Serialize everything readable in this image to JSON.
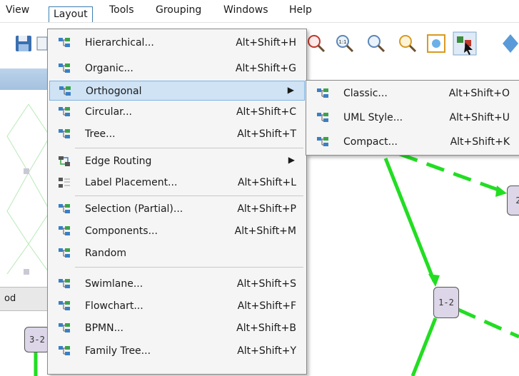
{
  "menubar": {
    "items": [
      {
        "label": "View"
      },
      {
        "label": "Layout"
      },
      {
        "label": "Tools"
      },
      {
        "label": "Grouping"
      },
      {
        "label": "Windows"
      },
      {
        "label": "Help"
      }
    ]
  },
  "layout_menu": {
    "items": [
      {
        "label": "Hierarchical...",
        "shortcut": "Alt+Shift+H",
        "icon": "layout-icon"
      },
      {
        "label": "Organic...",
        "shortcut": "Alt+Shift+G",
        "icon": "layout-icon"
      },
      {
        "label": "Orthogonal",
        "shortcut": "",
        "icon": "layout-icon",
        "submenu": true,
        "highlighted": true
      },
      {
        "label": "Circular...",
        "shortcut": "Alt+Shift+C",
        "icon": "layout-icon"
      },
      {
        "label": "Tree...",
        "shortcut": "Alt+Shift+T",
        "icon": "layout-icon"
      },
      {
        "label": "Edge Routing",
        "shortcut": "",
        "icon": "edge-routing-icon",
        "submenu": true
      },
      {
        "label": "Label Placement...",
        "shortcut": "Alt+Shift+L",
        "icon": "label-placement-icon"
      },
      {
        "label": "Selection (Partial)...",
        "shortcut": "Alt+Shift+P",
        "icon": "layout-icon"
      },
      {
        "label": "Components...",
        "shortcut": "Alt+Shift+M",
        "icon": "layout-icon"
      },
      {
        "label": "Random",
        "shortcut": "",
        "icon": "layout-icon"
      },
      {
        "label": "Swimlane...",
        "shortcut": "Alt+Shift+S",
        "icon": "layout-icon"
      },
      {
        "label": "Flowchart...",
        "shortcut": "Alt+Shift+F",
        "icon": "layout-icon"
      },
      {
        "label": "BPMN...",
        "shortcut": "Alt+Shift+B",
        "icon": "layout-icon"
      },
      {
        "label": "Family Tree...",
        "shortcut": "Alt+Shift+Y",
        "icon": "layout-icon"
      }
    ]
  },
  "orthogonal_submenu": {
    "items": [
      {
        "label": "Classic...",
        "shortcut": "Alt+Shift+O",
        "icon": "layout-icon"
      },
      {
        "label": "UML Style...",
        "shortcut": "Alt+Shift+U",
        "icon": "layout-icon"
      },
      {
        "label": "Compact...",
        "shortcut": "Alt+Shift+K",
        "icon": "layout-icon"
      }
    ]
  },
  "canvas": {
    "nodes": [
      {
        "label": "1-2"
      },
      {
        "label": "3-2"
      },
      {
        "label": "2"
      }
    ],
    "tab_label": "od"
  },
  "colors": {
    "edge_green": "#22dd22",
    "node_fill": "#dcd6e8",
    "menu_highlight": "#cfe3f5",
    "menu_bg": "#f5f5f5",
    "icon_blue": "#3a7fc4",
    "icon_green": "#3aa34a"
  }
}
